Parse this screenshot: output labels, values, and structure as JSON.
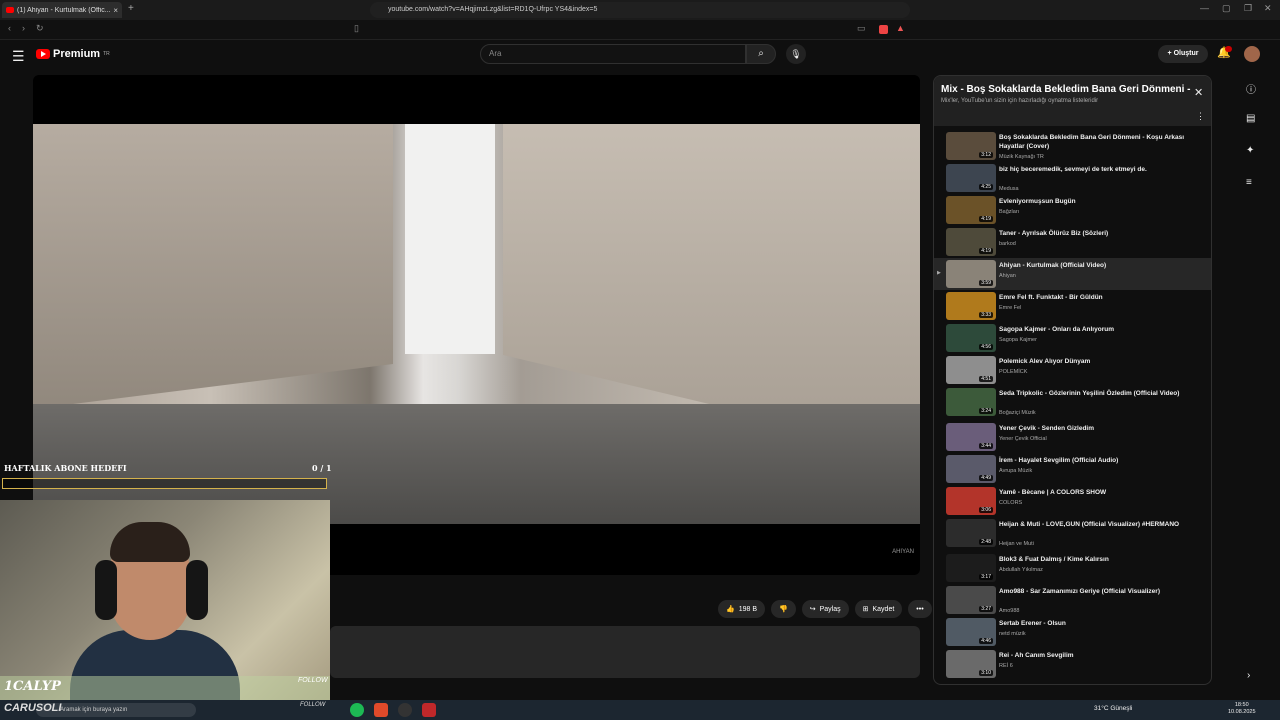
{
  "browser": {
    "tab_title": "(1) Ahiyan - Kurtulmak (Offic...",
    "tab_close": "×",
    "new_tab": "+",
    "url": "youtube.com/watch?v=AHqjimzLzg&list=RD1Q-Ufrpc YS4&index=5"
  },
  "youtube": {
    "logo_text": "Premium",
    "logo_sup": "TR",
    "search_placeholder": "Ara",
    "create_label": "Oluştur",
    "bell_badge": "9+"
  },
  "video": {
    "watermark": "AHIYAN",
    "like_count": "198 B",
    "share_label": "Paylaş",
    "save_label": "Kaydet",
    "more_label": "•••"
  },
  "overlay": {
    "goal_title": "HAFTALIK ABONE HEDEFI",
    "goal_count": "0 / 1",
    "name1": "1CALYP",
    "follow1": "FOLLOW",
    "name2": "CARUSOLI",
    "follow2": "FOLLOW",
    "taskbar_search": "Aramak için buraya yazın"
  },
  "playlist": {
    "title": "Mix - Boş Sokaklarda Bekledim Bana Geri Dönmeni -...",
    "subtitle": "Mix'ler, YouTube'un sizin için hazırladığı oynatma listeleridir",
    "items": [
      {
        "title": "Boş Sokaklarda Bekledim Bana Geri Dönmeni - Koşu Arkası Hayatlar (Cover)",
        "channel": "Müzik Kaynağı TR",
        "duration": "3:12",
        "color": "#5a4c3c"
      },
      {
        "title": "biz hiç beceremedik, sevmeyi de terk etmeyi de.",
        "channel": "Medusa",
        "duration": "4:25",
        "color": "#3d4550"
      },
      {
        "title": "Evleniyormuşsun Bugün",
        "channel": "Bağzları",
        "duration": "4:19",
        "color": "#6b5228"
      },
      {
        "title": "Taner - Ayrılsak Ölürüz Biz (Sözleri)",
        "channel": "barkod",
        "duration": "4:19",
        "color": "#4e4a3a"
      },
      {
        "title": "Ahiyan - Kurtulmak (Official Video)",
        "channel": "Ahiyan",
        "duration": "3:59",
        "color": "#8a8378"
      },
      {
        "title": "Emre Fel ft. Funktakt - Bir Güldün",
        "channel": "Emre Fel",
        "duration": "3:33",
        "color": "#b07a1c"
      },
      {
        "title": "Sagopa Kajmer - Onları da Anlıyorum",
        "channel": "Sagopa Kajmer",
        "duration": "4:56",
        "color": "#2d4a3a"
      },
      {
        "title": "Polemick Alev Alıyor Dünyam",
        "channel": "POLEMİCK",
        "duration": "4:51",
        "color": "#8e8e8e"
      },
      {
        "title": "Seda Tripkolic - Gözlerinin Yeşilini Özledim (Official Video)",
        "channel": "Boğaziçi Müzik",
        "duration": "3:24",
        "color": "#3c5a3a"
      },
      {
        "title": "Yener Çevik - Senden Gizledim",
        "channel": "Yener Çevik Official",
        "duration": "3:44",
        "color": "#6a5d7a"
      },
      {
        "title": "İrem - Hayalet Sevgilim (Official Audio)",
        "channel": "Avrupa Müzik",
        "duration": "4:49",
        "color": "#5a5a6a"
      },
      {
        "title": "Yamê - Bècane | A COLORS SHOW",
        "channel": "COLORS",
        "duration": "3:06",
        "color": "#b3342a"
      },
      {
        "title": "Heijan & Muti - LOVE,GUN (Official Visualizer) #HERMANO",
        "channel": "Heijan ve Muti",
        "duration": "2:48",
        "color": "#2c2c2c"
      },
      {
        "title": "Blok3 & Fuat Dalmış / Kime Kalırsın",
        "channel": "Abdullah Yıkılmaz",
        "duration": "3:17",
        "color": "#1c1c1c"
      },
      {
        "title": "Amo988 - Sar Zamanımızı Geriye (Official Visualizer)",
        "channel": "Amo988",
        "duration": "3:27",
        "color": "#4a4a4a"
      },
      {
        "title": "Sertab Erener - Olsun",
        "channel": "netd müzik",
        "duration": "4:46",
        "color": "#505a64"
      },
      {
        "title": "Rei - Ah Canım Sevgilim",
        "channel": "REİ 6",
        "duration": "3:10",
        "color": "#6a6a6a"
      }
    ],
    "current_index_marker": "▶"
  },
  "taskbar": {
    "weather": "31°C Güneşli",
    "time": "18:50",
    "date": "10.08.2025"
  }
}
